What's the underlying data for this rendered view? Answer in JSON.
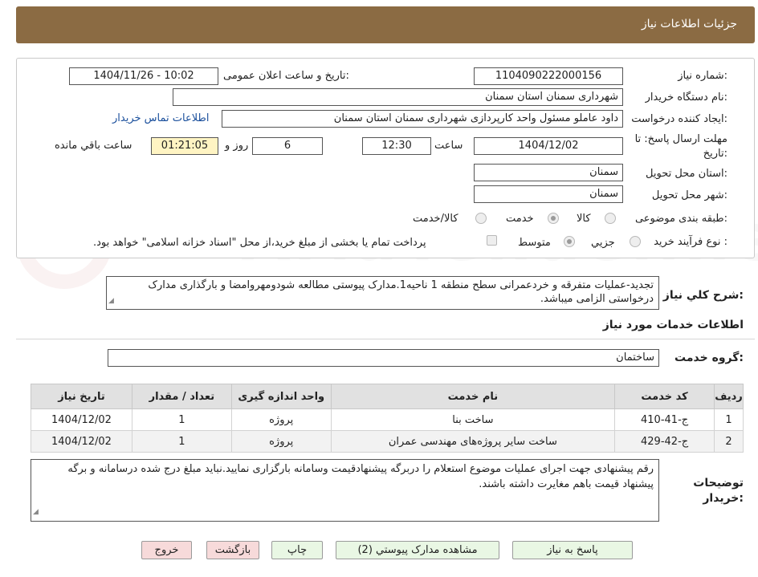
{
  "header": {
    "title": "جزئیات اطلاعات نیاز"
  },
  "watermark": "AriaTender.neT",
  "fields": {
    "need_number": {
      "label": "شماره نیاز:",
      "value": "1104090222000156"
    },
    "announce": {
      "label": "تاریخ و ساعت اعلان عمومی:",
      "value": "1404/11/26 - 10:02"
    },
    "buyer_org": {
      "label": "نام دستگاه خریدار:",
      "value": "شهرداری سمنان استان سمنان"
    },
    "requester": {
      "label": "ایجاد کننده درخواست:",
      "value": "داود عاملو مسئول واحد کارپردازی شهرداری سمنان استان سمنان",
      "contact_link": "اطلاعات تماس خریدار"
    },
    "deadline": {
      "label_line1": "مهلت ارسال پاسخ: تا",
      "label_line2": "تاریخ:",
      "date": "1404/12/02",
      "time_label": "ساعت",
      "time": "12:30",
      "days": "6",
      "days_label": "روز و",
      "remaining": "01:21:05",
      "remaining_label": "ساعت باقي مانده"
    },
    "province": {
      "label": "استان محل تحویل:",
      "value": "سمنان"
    },
    "city": {
      "label": "شهر محل تحویل:",
      "value": "سمنان"
    },
    "category": {
      "label": "طبقه بندی موضوعی:",
      "options": [
        "کالا",
        "خدمت",
        "کالا/خدمت"
      ],
      "selected": "خدمت"
    },
    "purchase_type": {
      "label": "نوع فرآیند خرید :",
      "options": [
        "جزیي",
        "متوسط"
      ],
      "selected": "متوسط",
      "note": "پرداخت تمام یا بخشی از مبلغ خرید،از محل \"اسناد خزانه اسلامی\" خواهد بود."
    }
  },
  "description": {
    "label": "شرح کلي نیاز:",
    "value": "تجدید-عملیات متفرقه و خردعمرانی سطح منطقه 1 ناحیه1.مدارک پیوستی مطالعه شودومهروامضا و بارگذاری مدارک درخواستی الزامی میباشد."
  },
  "services_section": {
    "title": "اطلاعات خدمات مورد نیاز",
    "group_label": "گروه خدمت:",
    "group_value": "ساختمان"
  },
  "table": {
    "headers": [
      "ردیف",
      "کد خدمت",
      "نام خدمت",
      "واحد اندازه گیری",
      "تعداد / مقدار",
      "تاریخ نیاز"
    ],
    "rows": [
      [
        "1",
        "ج-41-410",
        "ساخت بنا",
        "پروژه",
        "1",
        "1404/12/02"
      ],
      [
        "2",
        "ج-42-429",
        "ساخت سایر پروژه‌های مهندسی عمران",
        "پروژه",
        "1",
        "1404/12/02"
      ]
    ]
  },
  "buyer_notes": {
    "label_line1": "توضیحات",
    "label_line2": "خریدار:",
    "value": "رقم پیشنهادی جهت اجرای عملیات موضوع استعلام را دربرگه پیشنهادقیمت وسامانه بارگزاری نمایید.نباید مبلغ درج شده درسامانه و برگه پیشنهاد قیمت باهم مغایرت داشته باشند."
  },
  "buttons": {
    "reply": "پاسخ به نیاز",
    "attachments": "مشاهده مدارک پیوستي (2)",
    "print": "چاپ",
    "back": "بازگشت",
    "exit": "خروج"
  },
  "colors": {
    "header": "#8b6b43",
    "link": "#1a4f9c",
    "button_green": "#e9f7e4",
    "button_pink": "#f7dada",
    "timer_yellow": "#fff4c3"
  }
}
